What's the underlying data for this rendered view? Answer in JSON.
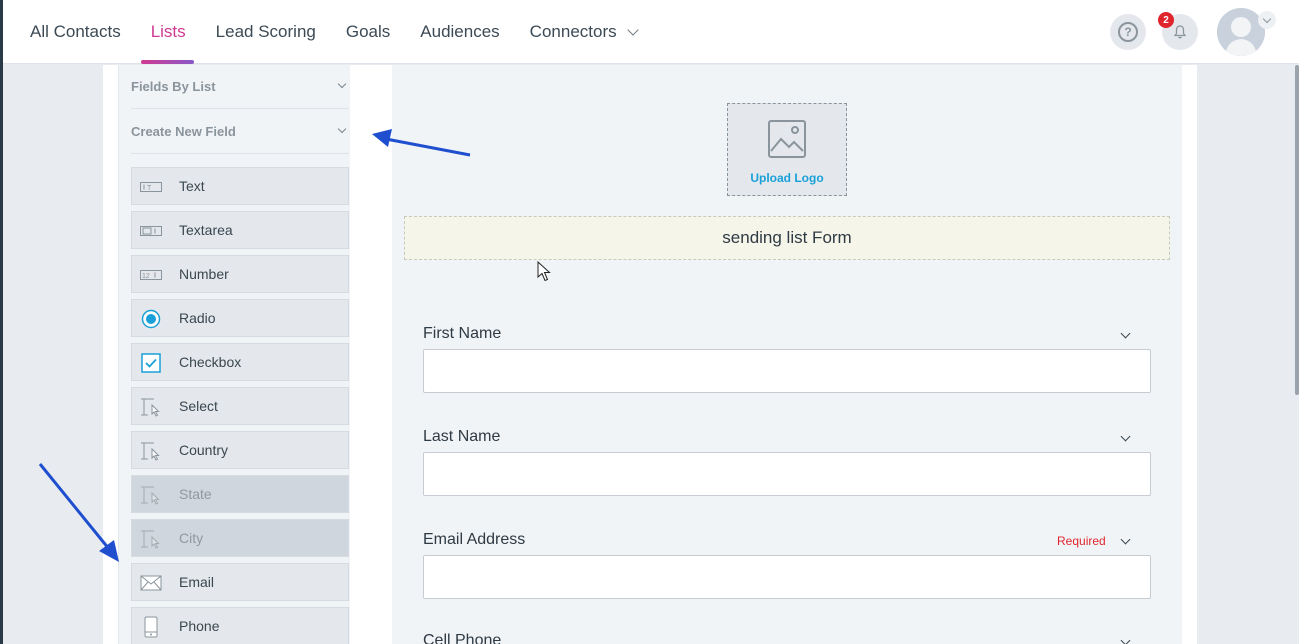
{
  "nav": {
    "items": [
      "All Contacts",
      "Lists",
      "Lead Scoring",
      "Goals",
      "Audiences",
      "Connectors"
    ],
    "active_index": 1
  },
  "header": {
    "notification_count": "2",
    "help_icon": "question-circle-icon",
    "bell_icon": "bell-icon"
  },
  "sidebar": {
    "sections": [
      "Fields By List",
      "Create New Field"
    ],
    "fields": [
      {
        "label": "Text",
        "icon": "text-field-icon",
        "disabled": false
      },
      {
        "label": "Textarea",
        "icon": "textarea-field-icon",
        "disabled": false
      },
      {
        "label": "Number",
        "icon": "number-field-icon",
        "disabled": false
      },
      {
        "label": "Radio",
        "icon": "radio-icon",
        "disabled": false
      },
      {
        "label": "Checkbox",
        "icon": "checkbox-icon",
        "disabled": false
      },
      {
        "label": "Select",
        "icon": "select-cursor-icon",
        "disabled": false
      },
      {
        "label": "Country",
        "icon": "select-cursor-icon",
        "disabled": false
      },
      {
        "label": "State",
        "icon": "select-cursor-icon",
        "disabled": true
      },
      {
        "label": "City",
        "icon": "select-cursor-icon",
        "disabled": true
      },
      {
        "label": "Email",
        "icon": "envelope-icon",
        "disabled": false
      },
      {
        "label": "Phone",
        "icon": "phone-icon",
        "disabled": false
      }
    ]
  },
  "form": {
    "upload_label": "Upload Logo",
    "title": "sending list Form",
    "fields": [
      {
        "label": "First Name",
        "required": ""
      },
      {
        "label": "Last Name",
        "required": ""
      },
      {
        "label": "Email Address",
        "required": "Required"
      },
      {
        "label": "Cell Phone",
        "required": ""
      }
    ]
  },
  "colors": {
    "accent": "#d03a92",
    "link": "#1aa0d8",
    "required": "#e0262d",
    "annotation_arrow": "#1f4fcf"
  }
}
